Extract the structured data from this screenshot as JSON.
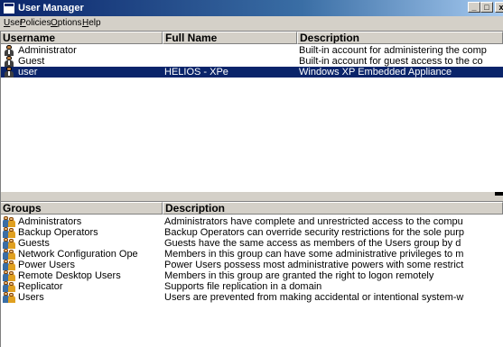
{
  "window": {
    "title": "User Manager"
  },
  "menu": [
    "User",
    "Policies",
    "Options",
    "Help"
  ],
  "users": {
    "columns": [
      "Username",
      "Full Name",
      "Description"
    ],
    "rows": [
      {
        "username": "Administrator",
        "full_name": "",
        "description": "Built-in account for administering the comp",
        "selected": false
      },
      {
        "username": "Guest",
        "full_name": "",
        "description": "Built-in account for guest access to the co",
        "selected": false
      },
      {
        "username": "user",
        "full_name": "HELIOS - XPe",
        "description": "Windows XP Embedded Appliance",
        "selected": true
      }
    ]
  },
  "groups": {
    "columns": [
      "Groups",
      "Description"
    ],
    "rows": [
      {
        "name": "Administrators",
        "description": "Administrators have complete and unrestricted access to the compu"
      },
      {
        "name": "Backup Operators",
        "description": "Backup Operators can override security restrictions for the sole purp"
      },
      {
        "name": "Guests",
        "description": "Guests have the same access as members of the Users group by d"
      },
      {
        "name": "Network Configuration Ope",
        "description": "Members in this group can have some administrative privileges to m"
      },
      {
        "name": "Power Users",
        "description": "Power Users possess most administrative powers with some restrict"
      },
      {
        "name": "Remote Desktop Users",
        "description": "Members in this group are granted the right to logon remotely"
      },
      {
        "name": "Replicator",
        "description": "Supports file replication in a domain"
      },
      {
        "name": "Users",
        "description": "Users are prevented from making accidental or intentional system-w"
      }
    ]
  },
  "colors": {
    "title_start": "#0a246a",
    "title_end": "#a6caf0",
    "selection": "#0a246a",
    "chrome": "#d4d0c8"
  },
  "icons": {
    "app": "user-manager-icon",
    "user": "user-icon",
    "group": "group-icon"
  }
}
